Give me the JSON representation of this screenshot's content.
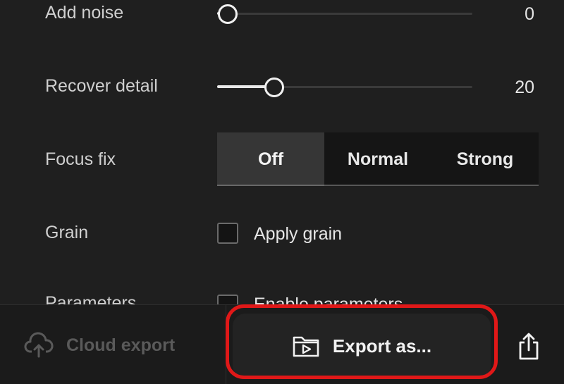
{
  "settings": {
    "add_noise": {
      "label": "Add noise",
      "value": "0",
      "level": 0.04
    },
    "recover_detail": {
      "label": "Recover detail",
      "value": "20",
      "level": 0.22
    },
    "focus_fix": {
      "label": "Focus fix",
      "options": [
        "Off",
        "Normal",
        "Strong"
      ],
      "selected": "Off"
    },
    "grain": {
      "label": "Grain",
      "checkbox_label": "Apply grain",
      "checked": false
    },
    "parameters": {
      "label": "Parameters",
      "checkbox_label": "Enable parameters",
      "checked": false
    }
  },
  "footer": {
    "cloud_export_label": "Cloud export",
    "export_as_label": "Export as...",
    "icons": [
      "cloud-upload-icon",
      "folder-play-icon",
      "share-icon"
    ]
  },
  "colors": {
    "highlight": "#e01818",
    "background": "#1f1f1f"
  }
}
